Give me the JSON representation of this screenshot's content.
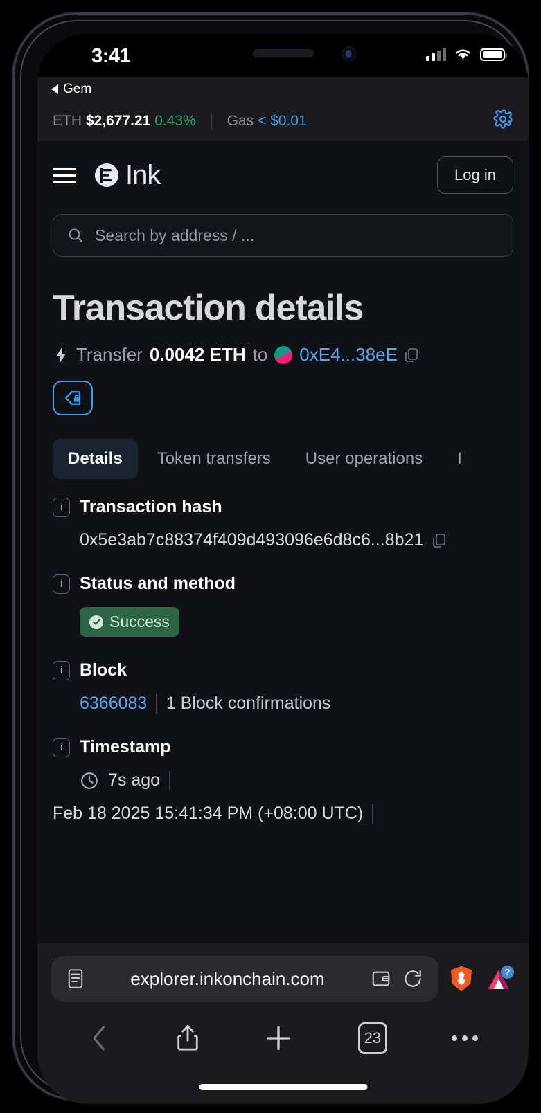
{
  "device": {
    "status_bar": {
      "time": "3:41",
      "signal_icon": "cellular-signal-icon",
      "wifi_icon": "wifi-icon",
      "battery_icon": "battery-icon"
    },
    "back_to_app": {
      "label": "Gem",
      "icon": "back-triangle-icon"
    },
    "home_indicator": "home-indicator"
  },
  "site_topbar": {
    "eth_label": "ETH",
    "eth_price": "$2,677.21",
    "eth_change": "0.43%",
    "gas_label": "Gas",
    "gas_value": "< $0.01",
    "settings_icon": "gear-icon"
  },
  "app_header": {
    "menu_icon": "hamburger-menu-icon",
    "logo_text": "Ink",
    "logo_mark": "ink-logo-icon",
    "login_label": "Log in"
  },
  "search": {
    "placeholder": "Search by address / ...",
    "icon": "search-icon"
  },
  "main": {
    "title": "Transaction details",
    "transfer": {
      "bolt_icon": "lightning-bolt-icon",
      "action": "Transfer",
      "amount": "0.0042 ETH",
      "to_label": "to",
      "address": "0xE4...38eE",
      "avatar": "address-avatar",
      "copy_icon": "copy-icon"
    },
    "tag_button": {
      "icon": "private-tag-icon"
    },
    "tabs": [
      {
        "label": "Details",
        "active": true
      },
      {
        "label": "Token transfers",
        "active": false
      },
      {
        "label": "User operations",
        "active": false
      },
      {
        "label": "I",
        "active": false
      }
    ],
    "details": [
      {
        "label": "Transaction hash",
        "value": "0x5e3ab7c88374f409d493096e6d8c6...8b21",
        "copy_icon": "copy-icon",
        "info_icon": "info-icon"
      },
      {
        "label": "Status and method",
        "status": "Success",
        "status_color": "#2c6446",
        "info_icon": "info-icon"
      },
      {
        "label": "Block",
        "block_number": "6366083",
        "confirmations": "1 Block confirmations",
        "info_icon": "info-icon"
      },
      {
        "label": "Timestamp",
        "relative": "7s ago",
        "absolute": "Feb 18 2025 15:41:34 PM (+08:00 UTC)",
        "clock_icon": "clock-icon",
        "info_icon": "info-icon"
      }
    ]
  },
  "browser": {
    "reader_icon": "reader-view-icon",
    "url": "explorer.inkonchain.com",
    "wallet_icon": "wallet-icon",
    "reload_icon": "reload-icon",
    "brave_icon": "brave-lion-icon",
    "rewards_icon": "brave-rewards-bat-icon",
    "rewards_badge": "?",
    "nav": {
      "back_icon": "back-chevron-icon",
      "share_icon": "share-icon",
      "new_tab_icon": "plus-icon",
      "tab_count": "23",
      "more_icon": "more-options-icon"
    }
  },
  "colors": {
    "accent_blue": "#54a7f2",
    "success_green": "#2c6446",
    "change_green": "#25a464",
    "page_bg": "#101114",
    "chrome_bg": "#1b1b1e"
  }
}
